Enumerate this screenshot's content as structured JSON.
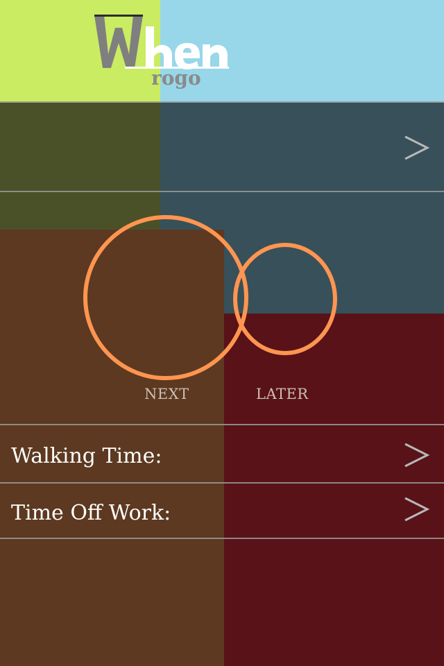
{
  "app": {
    "logo_text": "When",
    "logo_subtext": "rogo"
  },
  "colors": {
    "lime": "#c9ec62",
    "sky": "#97d7e9",
    "olive": "#4a5028",
    "slate": "#37505a",
    "brown": "#5c3920",
    "maroon": "#581218",
    "accent": "#ff9550"
  },
  "options": {
    "next_label": "NEXT",
    "later_label": "LATER"
  },
  "settings": [
    {
      "label": "Walking Time:",
      "icon": "chevron-right-icon"
    },
    {
      "label": "Time Off Work:",
      "icon": "chevron-right-icon"
    }
  ],
  "top_row": {
    "icon": "chevron-right-icon"
  }
}
